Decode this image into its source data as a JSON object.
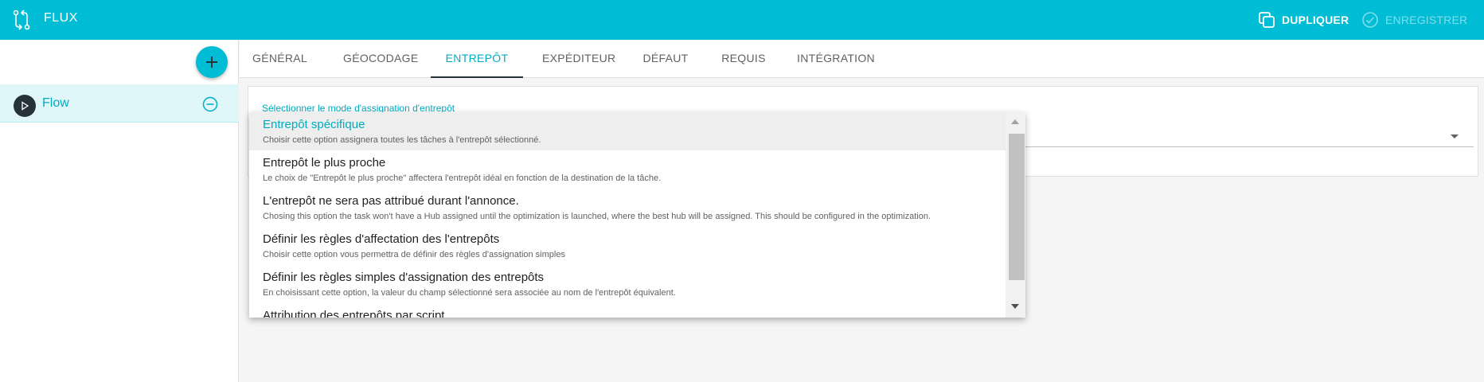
{
  "header": {
    "title": "FLUX",
    "duplicate_label": "DUPLIQUER",
    "save_label": "ENREGISTRER"
  },
  "sidebar": {
    "items": [
      {
        "label": "Flow"
      }
    ]
  },
  "tabs": [
    {
      "label": "GÉNÉRAL"
    },
    {
      "label": "GÉOCODAGE"
    },
    {
      "label": "ENTREPÔT"
    },
    {
      "label": "EXPÉDITEUR"
    },
    {
      "label": "DÉFAUT"
    },
    {
      "label": "REQUIS"
    },
    {
      "label": "INTÉGRATION"
    }
  ],
  "active_tab": "ENTREPÔT",
  "field": {
    "label": "Sélectionner le mode d'assignation d'entrepôt"
  },
  "dropdown": {
    "options": [
      {
        "title": "Entrepôt spécifique",
        "desc": "Choisir cette option assignera toutes les tâches à l'entrepôt sélectionné."
      },
      {
        "title": "Entrepôt le plus proche",
        "desc": "Le choix de \"Entrepôt le plus proche\" affectera l'entrepôt idéal en fonction de la destination de la tâche."
      },
      {
        "title": "L'entrepôt ne sera pas attribué durant l'annonce.",
        "desc": "Chosing this option the task won't have a Hub assigned until the optimization is launched, where the best hub will be assigned. This should be configured in the optimization."
      },
      {
        "title": "Définir les règles d'affectation des l'entrepôts",
        "desc": "Choisir cette option vous permettra de définir des règles d'assignation simples"
      },
      {
        "title": "Définir les règles simples d'assignation des entrepôts",
        "desc": "En choisissant cette option, la valeur du champ sélectionné sera associée au nom de l'entrepôt équivalent."
      },
      {
        "title": "Attribution des entrepôts par script",
        "desc": ""
      }
    ],
    "selected": "Entrepôt spécifique"
  },
  "colors": {
    "accent": "#00bcd4",
    "accent_text": "#00acc1",
    "dark": "#263238"
  },
  "icons": {
    "app": "flow-arrows-icon",
    "duplicate": "copy-icon",
    "save": "check-circle-icon",
    "add": "plus-icon",
    "play": "play-icon",
    "remove": "minus-circle-icon"
  }
}
